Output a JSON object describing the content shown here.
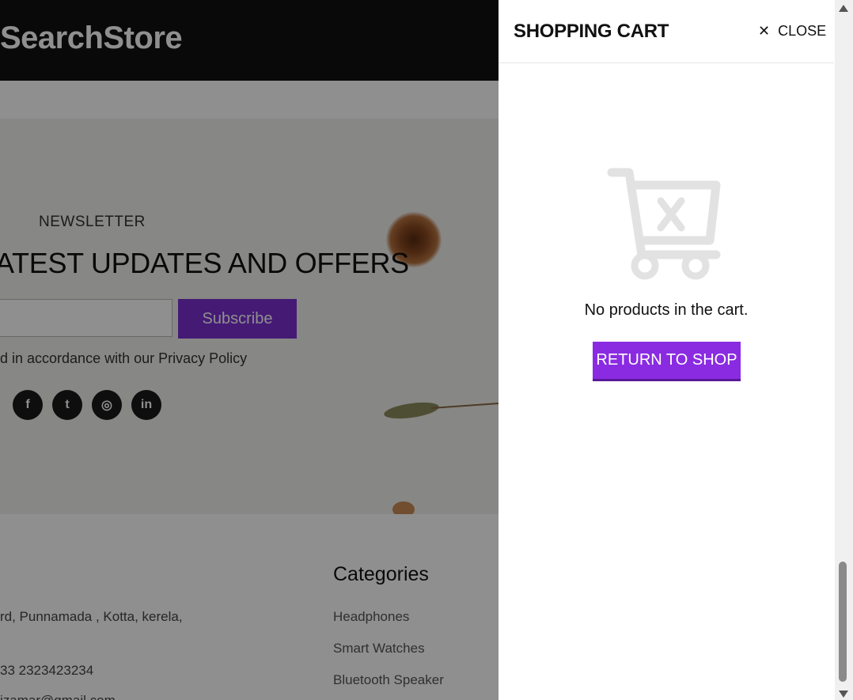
{
  "site": {
    "logo": "SearchStore"
  },
  "newsletter": {
    "label": "NEWSLETTER",
    "title": "ATEST UPDATES AND OFFERS",
    "subscribe_label": "Subscribe",
    "note": "d in accordance with our Privacy Policy",
    "socials": [
      {
        "icon": "facebook-icon",
        "glyph": "f"
      },
      {
        "icon": "twitter-icon",
        "glyph": "t"
      },
      {
        "icon": "instagram-icon",
        "glyph": "◎"
      },
      {
        "icon": "linkedin-icon",
        "glyph": "in"
      }
    ]
  },
  "footer": {
    "address": "rd, Punnamada , Kotta, kerela,",
    "phone": "33 2323423234",
    "email": "izamar@gmail.com",
    "categories_title": "Categories",
    "categories": [
      "Headphones",
      "Smart Watches",
      "Bluetooth Speaker"
    ]
  },
  "cart": {
    "title": "SHOPPING CART",
    "close_label": "CLOSE",
    "empty_message": "No products in the cart.",
    "return_label": "RETURN TO SHOP",
    "accent_color": "#8a2be2"
  },
  "scroll": {
    "thumb_position": 0.82
  }
}
